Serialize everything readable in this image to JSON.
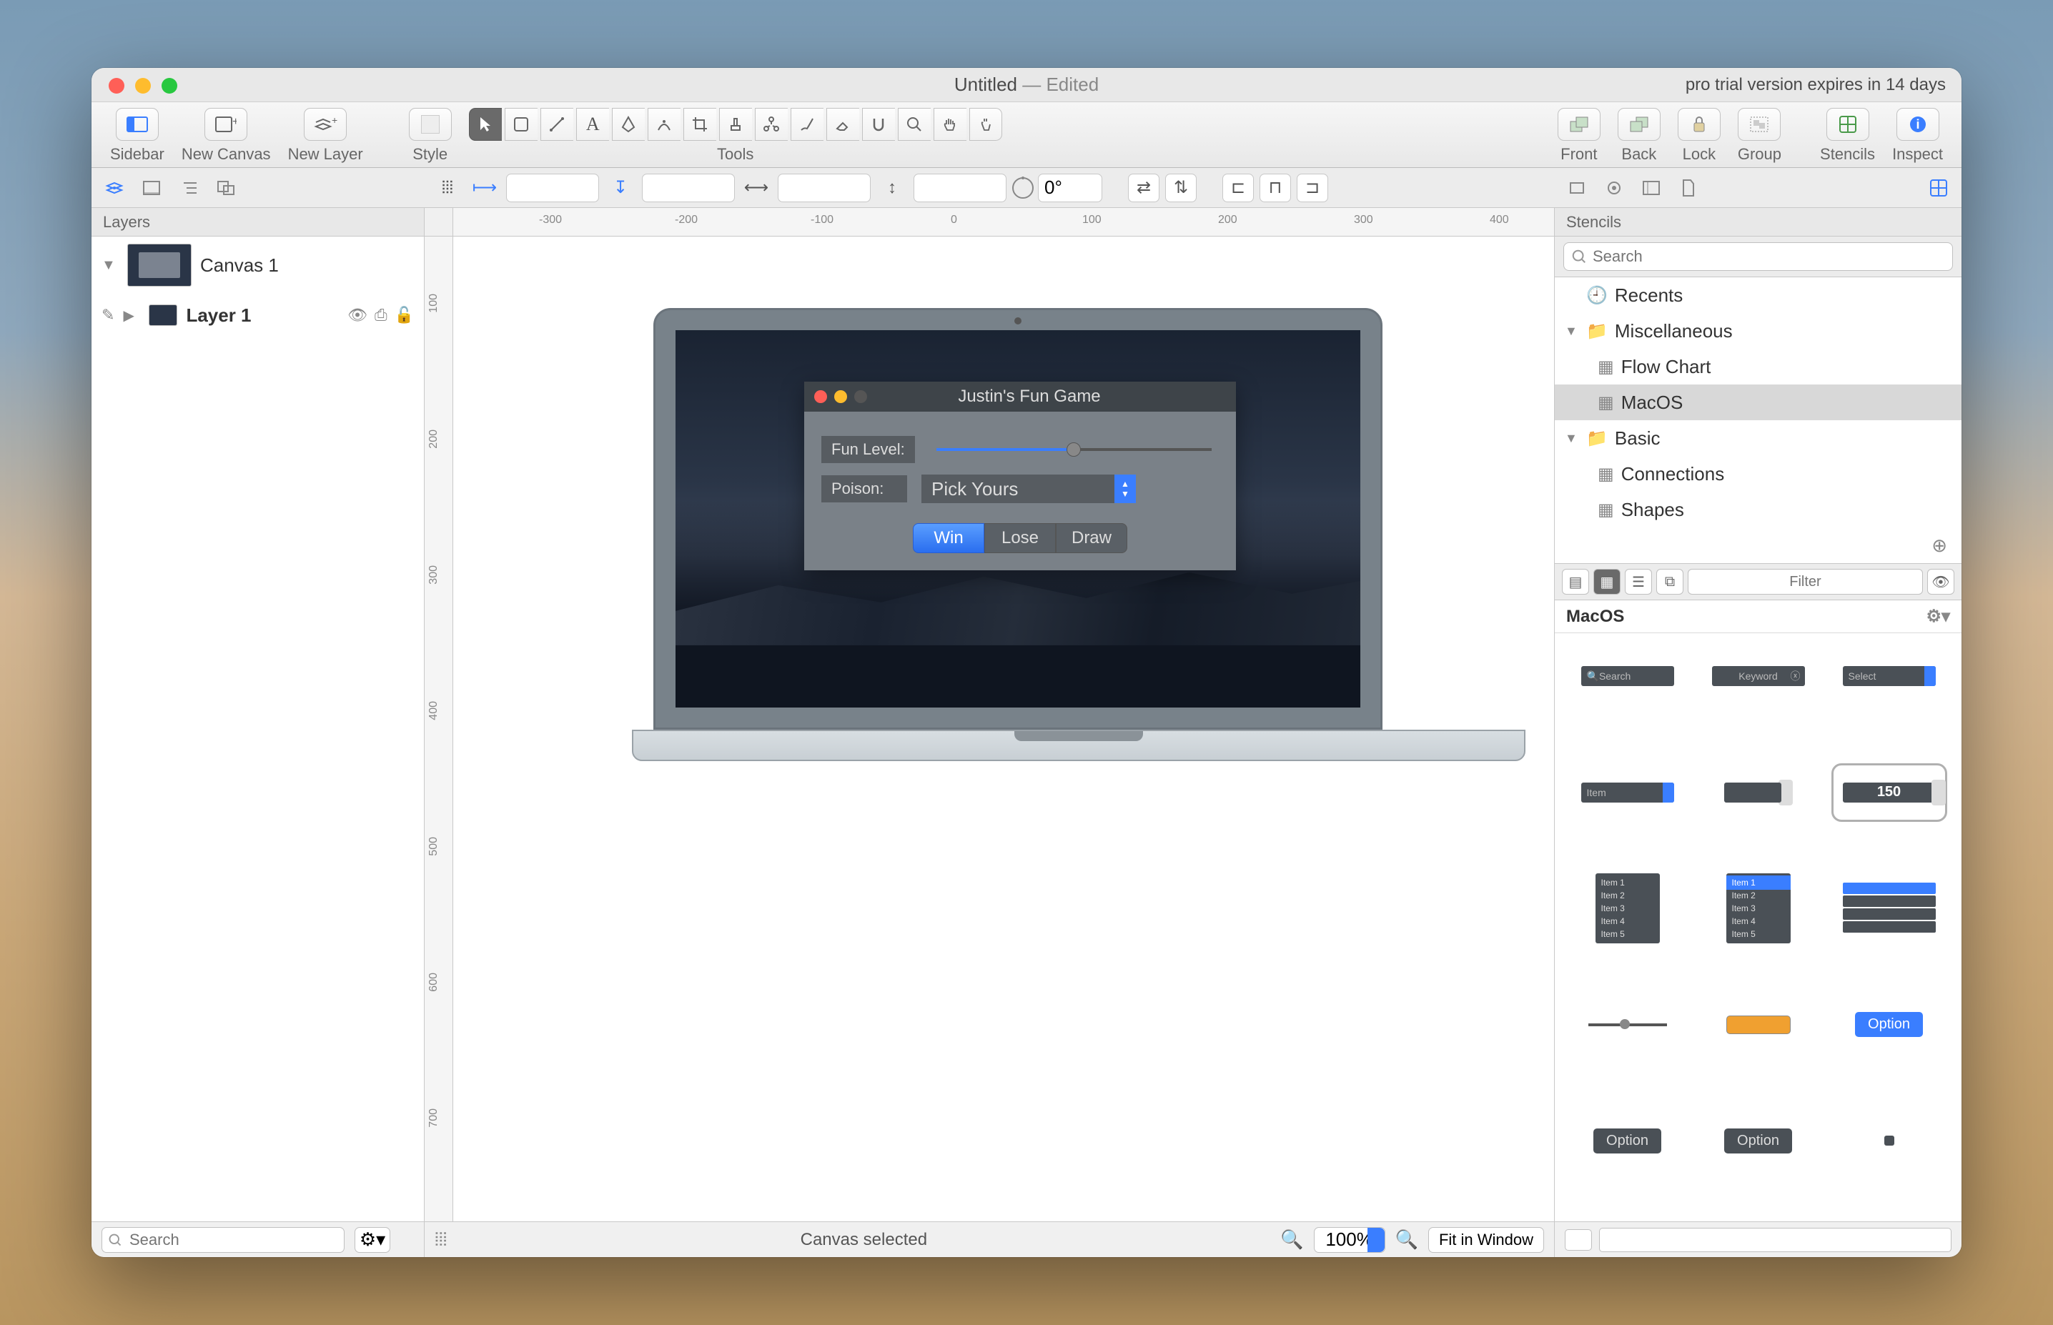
{
  "window": {
    "title": "Untitled",
    "edited": "— Edited",
    "trial": "pro trial version expires in 14 days"
  },
  "toolbar": {
    "sidebar": "Sidebar",
    "new_canvas": "New Canvas",
    "new_layer": "New Layer",
    "style": "Style",
    "tools": "Tools",
    "front": "Front",
    "back": "Back",
    "lock": "Lock",
    "group": "Group",
    "stencils": "Stencils",
    "inspect": "Inspect"
  },
  "rotation": "0°",
  "left": {
    "section": "Layers",
    "canvas": "Canvas 1",
    "layer": "Layer 1"
  },
  "ruler_h": [
    "-300",
    "-200",
    "-100",
    "0",
    "100",
    "200",
    "300",
    "400"
  ],
  "ruler_v": [
    "100",
    "200",
    "300",
    "400",
    "500",
    "600",
    "700"
  ],
  "dialog": {
    "title": "Justin's Fun Game",
    "fun_level": "Fun Level:",
    "poison": "Poison:",
    "pick_yours": "Pick Yours",
    "win": "Win",
    "lose": "Lose",
    "draw": "Draw"
  },
  "right": {
    "section": "Stencils",
    "search_placeholder": "Search",
    "recents": "Recents",
    "misc": "Miscellaneous",
    "flowchart": "Flow Chart",
    "macos": "MacOS",
    "basic": "Basic",
    "connections": "Connections",
    "shapes": "Shapes",
    "filter_placeholder": "Filter",
    "grid_title": "MacOS",
    "items": {
      "search": "Search",
      "keyword": "Keyword",
      "select": "Select",
      "item": "Item",
      "num": "150",
      "list": [
        "Item 1",
        "Item 2",
        "Item 3",
        "Item 4",
        "Item 5"
      ],
      "option": "Option"
    }
  },
  "status": {
    "search_placeholder": "Search",
    "center": "Canvas selected",
    "zoom": "100%",
    "fit": "Fit in Window"
  }
}
